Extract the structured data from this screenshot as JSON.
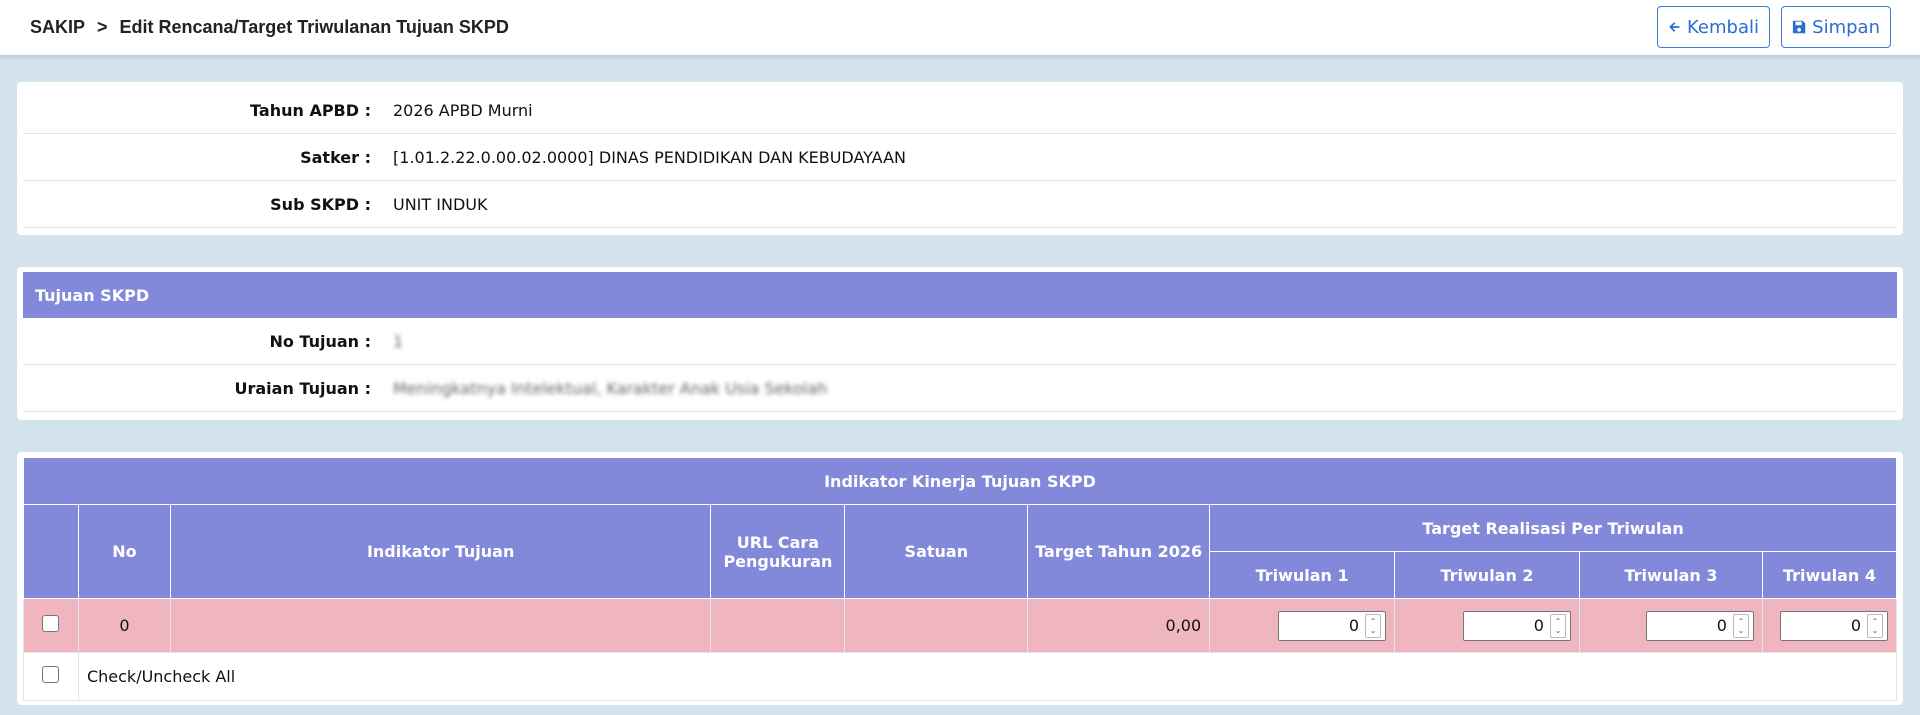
{
  "breadcrumb": {
    "root": "SAKIP",
    "separator": ">",
    "current": "Edit Rencana/Target Triwulanan Tujuan SKPD"
  },
  "toolbar": {
    "back_label": "Kembali",
    "save_label": "Simpan"
  },
  "info": {
    "tahun_label": "Tahun APBD :",
    "tahun_value": "2026 APBD Murni",
    "satker_label": "Satker :",
    "satker_value": "[1.01.2.22.0.00.02.0000] DINAS PENDIDIKAN DAN KEBUDAYAAN",
    "subskpd_label": "Sub SKPD :",
    "subskpd_value": "UNIT INDUK"
  },
  "tujuan": {
    "header": "Tujuan SKPD",
    "no_label": "No Tujuan :",
    "no_value": "1",
    "uraian_label": "Uraian Tujuan :",
    "uraian_value": "Meningkatnya Intelektual, Karakter Anak Usia Sekolah"
  },
  "indikator": {
    "title": "Indikator Kinerja Tujuan SKPD",
    "col_no": "No",
    "col_indikator": "Indikator Tujuan",
    "col_url": "URL Cara Pengukuran",
    "col_satuan": "Satuan",
    "col_target": "Target Tahun 2026",
    "col_realisasi": "Target Realisasi Per Triwulan",
    "tw1": "Triwulan 1",
    "tw2": "Triwulan 2",
    "tw3": "Triwulan 3",
    "tw4": "Triwulan 4",
    "row": {
      "no": "0",
      "indikator": "",
      "url": "",
      "satuan": "",
      "target": "0,00",
      "tw1": "0",
      "tw2": "0",
      "tw3": "0",
      "tw4": "0"
    },
    "check_all_label": "Check/Uncheck All"
  },
  "colors": {
    "header_bg": "#8389da",
    "row_bg": "#f0b6c0",
    "accent": "#2a6ecf",
    "page_bg": "#d2e3ec"
  }
}
